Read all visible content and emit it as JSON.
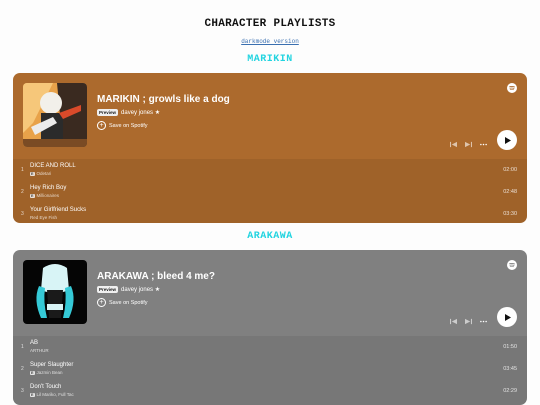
{
  "page": {
    "title": "CHARACTER PLAYLISTS",
    "dark_link": "darkmode version"
  },
  "sections": [
    {
      "heading": "MARIKIN",
      "player": {
        "title": "MARIKIN ; growls like a dog",
        "badge": "Preview",
        "owner": "davey jones ★",
        "save_label": "Save on Spotify",
        "bg_color": "#ac6a2d",
        "tracks": [
          {
            "num": "1",
            "name": "DICE AND ROLL",
            "explicit": "E",
            "artist": "Odetari",
            "duration": "02:00"
          },
          {
            "num": "2",
            "name": "Hey Rich Boy",
            "explicit": "E",
            "artist": "Millionaires",
            "duration": "02:48"
          },
          {
            "num": "3",
            "name": "Your Girlfriend Sucks",
            "explicit": "",
            "artist": "Red Eye Fish",
            "duration": "03:30"
          }
        ]
      }
    },
    {
      "heading": "ARAKAWA",
      "player": {
        "title": "ARAKAWA ; bleed 4 me?",
        "badge": "Preview",
        "owner": "davey jones ★",
        "save_label": "Save on Spotify",
        "bg_color": "#808080",
        "tracks": [
          {
            "num": "1",
            "name": "AB",
            "explicit": "",
            "artist": "ARTHUR",
            "duration": "01:50"
          },
          {
            "num": "2",
            "name": "Super Slaughter",
            "explicit": "E",
            "artist": "Jazmin Bean",
            "duration": "03:45"
          },
          {
            "num": "3",
            "name": "Don't Touch",
            "explicit": "E",
            "artist": "Lil Mariko, Full Tac",
            "duration": "02:29"
          }
        ]
      }
    }
  ],
  "icons": [
    "spotify-icon",
    "plus-circle-icon",
    "previous-track-icon",
    "next-track-icon",
    "more-options-icon",
    "play-icon",
    "album-cover-image"
  ]
}
